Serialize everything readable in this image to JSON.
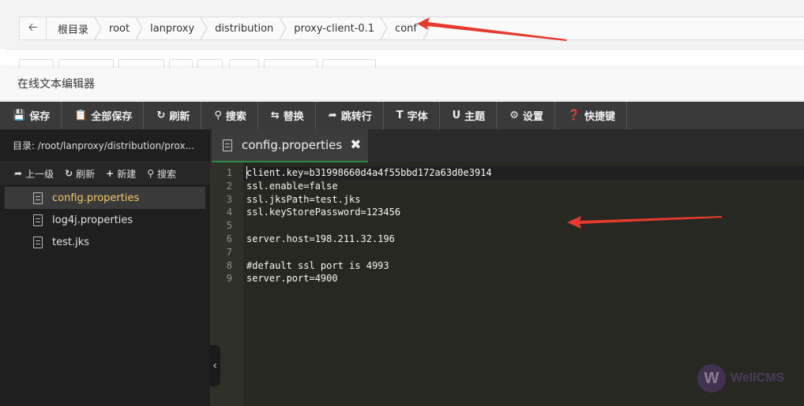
{
  "breadcrumb": {
    "back_icon": "arrow-left-icon",
    "items": [
      "根目录",
      "root",
      "lanproxy",
      "distribution",
      "proxy-client-0.1",
      "conf"
    ]
  },
  "modal": {
    "title": "在线文本编辑器"
  },
  "toolbar": {
    "buttons": [
      {
        "icon": "save-icon",
        "label": "保存"
      },
      {
        "icon": "save-all-icon",
        "label": "全部保存"
      },
      {
        "icon": "refresh-icon",
        "label": "刷新"
      },
      {
        "icon": "search-icon",
        "label": "搜索"
      },
      {
        "icon": "replace-icon",
        "label": "替换"
      },
      {
        "icon": "goto-line-icon",
        "label": "跳转行"
      },
      {
        "icon": "font-icon",
        "label": "字体"
      },
      {
        "icon": "theme-icon",
        "label": "主题"
      },
      {
        "icon": "gear-icon",
        "label": "设置"
      },
      {
        "icon": "question-icon",
        "label": "快捷键"
      }
    ]
  },
  "filepanel": {
    "path": "目录: /root/lanproxy/distribution/prox...",
    "actions": [
      {
        "icon": "share-icon",
        "label": "上一级"
      },
      {
        "icon": "refresh-icon",
        "label": "刷新"
      },
      {
        "icon": "plus-icon",
        "label": "新建"
      },
      {
        "icon": "search-icon",
        "label": "搜索"
      }
    ],
    "files": [
      "config.properties",
      "log4j.properties",
      "test.jks"
    ]
  },
  "tab": {
    "label": "config.properties",
    "close": "✖"
  },
  "editor": {
    "lines": [
      "client.key=b31998660d4a4f55bbd172a63d0e3914",
      "ssl.enable=false",
      "ssl.jksPath=test.jks",
      "ssl.keyStorePassword=123456",
      "",
      "server.host=198.211.32.196",
      "",
      "#default ssl port is 4993",
      "server.port=4900"
    ],
    "line_numbers": [
      "1",
      "2",
      "3",
      "4",
      "5",
      "6",
      "7",
      "8",
      "9"
    ]
  },
  "collapse_handle": "‹",
  "watermark": {
    "logo": "W",
    "text": "WellCMS"
  }
}
